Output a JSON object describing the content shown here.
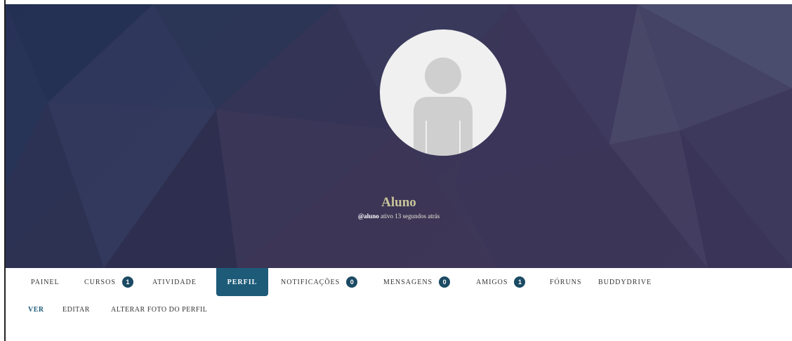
{
  "profile": {
    "name": "Aluno",
    "handle": "@aluno",
    "activity": "ativo 13 segundos atrás"
  },
  "main_nav": [
    {
      "label": "PAINEL"
    },
    {
      "label": "CURSOS",
      "badge": "1"
    },
    {
      "label": "ATIVIDADE"
    },
    {
      "label": "PERFIL",
      "active": true
    },
    {
      "label": "NOTIFICAÇÕES",
      "badge": "0"
    },
    {
      "label": "MENSAGENS",
      "badge": "0"
    },
    {
      "label": "AMIGOS",
      "badge": "1"
    },
    {
      "label": "FÓRUNS"
    },
    {
      "label": "BUDDYDRIVE"
    }
  ],
  "sub_nav": [
    {
      "label": "VER",
      "active": true
    },
    {
      "label": "EDITAR"
    },
    {
      "label": "ALTERAR FOTO DO PERFIL"
    }
  ],
  "colors": {
    "accent": "#1d5b78",
    "cover_base": "#353659",
    "name_color": "#c8c59a"
  }
}
